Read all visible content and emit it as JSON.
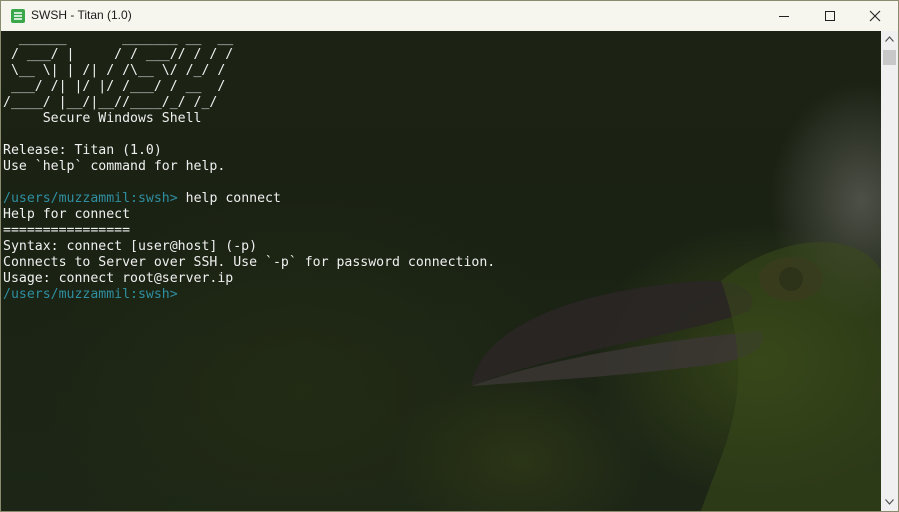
{
  "window": {
    "title": "SWSH - Titan (1.0)",
    "app_icon": "swsh-logo-icon",
    "controls": [
      "minimize-icon",
      "maximize-icon",
      "close-icon"
    ]
  },
  "terminal": {
    "banner": [
      "  ______       _______ __  __",
      " / ___/ |     / / ___// / / /",
      " \\__ \\| | /| / /\\__ \\/ /_/ /",
      " ___/ /| |/ |/ /___/ / __  /",
      "/____/ |__/|__//____/_/ /_/"
    ],
    "subtitle": "     Secure Windows Shell",
    "release_line": "Release: Titan (1.0)",
    "help_hint": "Use `help` command for help.",
    "prompt_path": "/users/muzzammil:",
    "prompt_host": "swsh>",
    "command": " help connect",
    "help_title": "Help for connect",
    "help_rule": "================",
    "syntax_line": "Syntax: connect [user@host] (-p)",
    "description_line": "Connects to Server over SSH. Use `-p` for password connection.",
    "usage_line": "Usage: connect root@server.ip",
    "prompt2_path": "/users/muzzammil:",
    "prompt2_host": "swsh>"
  },
  "colors": {
    "prompt": "#2f8ea0",
    "text": "#f0f0f0",
    "titlebar": "#f6f6ee",
    "accent_icon": "#3aa84a"
  }
}
